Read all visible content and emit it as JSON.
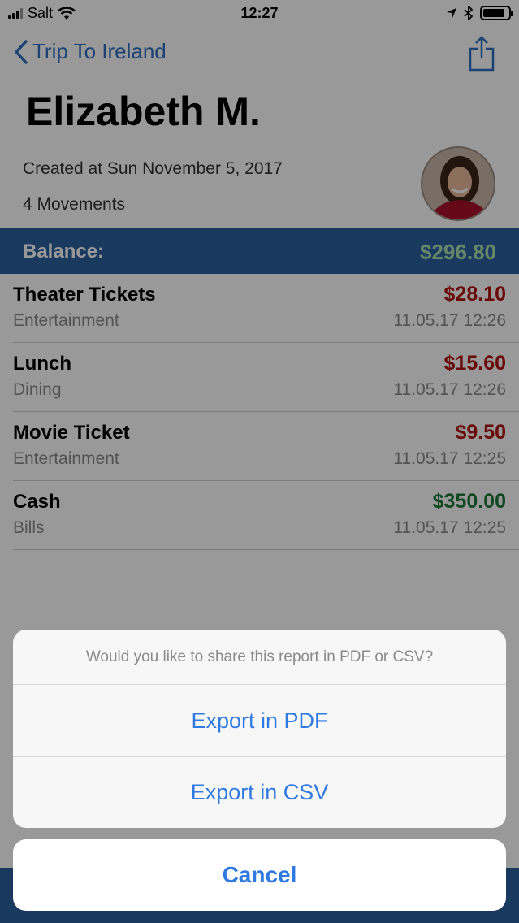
{
  "status_bar": {
    "carrier": "Salt",
    "time": "12:27",
    "battery_level": 0.85
  },
  "nav": {
    "back_label": "Trip To Ireland"
  },
  "profile": {
    "name": "Elizabeth M.",
    "created": "Created at Sun November 5, 2017",
    "movements": "4 Movements"
  },
  "balance": {
    "label": "Balance:",
    "value": "$296.80"
  },
  "transactions": [
    {
      "title": "Theater Tickets",
      "category": "Entertainment",
      "amount": "$28.10",
      "date": "11.05.17 12:26",
      "type": "expense"
    },
    {
      "title": "Lunch",
      "category": "Dining",
      "amount": "$15.60",
      "date": "11.05.17 12:26",
      "type": "expense"
    },
    {
      "title": "Movie Ticket",
      "category": "Entertainment",
      "amount": "$9.50",
      "date": "11.05.17 12:25",
      "type": "expense"
    },
    {
      "title": "Cash",
      "category": "Bills",
      "amount": "$350.00",
      "date": "11.05.17 12:25",
      "type": "income"
    }
  ],
  "action_sheet": {
    "message": "Would you like to share this report in PDF or CSV?",
    "export_pdf": "Export in PDF",
    "export_csv": "Export in CSV",
    "cancel": "Cancel"
  },
  "colors": {
    "accent": "#2f7ae0",
    "balance_bar": "#2c5f9e",
    "expense": "#b01010",
    "income": "#1f7a3a"
  }
}
